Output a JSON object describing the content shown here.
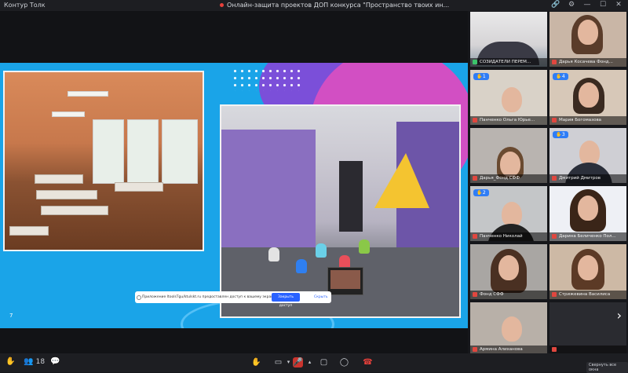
{
  "app": {
    "title": "Контур Толк"
  },
  "meeting": {
    "title": "Онлайн-защита проектов ДОП конкурса \"Пространство твоих ин..."
  },
  "top_icons": [
    "link-icon",
    "gear-icon",
    "minimize-icon",
    "maximize-icon",
    "close-icon"
  ],
  "slide": {
    "page_number": "7"
  },
  "share_notice": {
    "text": "Приложение ltoolsTgu/ktulskt.ru предоставлен доступ к вашему экрану.",
    "stop_label": "Закрыть доступ",
    "hide_label": "Скрыть"
  },
  "participants": [
    {
      "name": "СОЗИДАТЕЛИ ПЕРЕМ...",
      "mic_on": true,
      "badge": ""
    },
    {
      "name": "Дарья Косачева Фонд...",
      "mic_on": false,
      "badge": ""
    },
    {
      "name": "Панченко Ольга Юрье...",
      "mic_on": false,
      "badge": "1"
    },
    {
      "name": "Мария Богомазова",
      "mic_on": false,
      "badge": "4"
    },
    {
      "name": "Дарья_Фонд СФФ",
      "mic_on": false,
      "badge": ""
    },
    {
      "name": "Дмитрий Дмитров",
      "mic_on": false,
      "badge": "3"
    },
    {
      "name": "Панченко Николай",
      "mic_on": false,
      "badge": "2"
    },
    {
      "name": "Дарина Беличенко Пол...",
      "mic_on": false,
      "badge": ""
    },
    {
      "name": "Фонд СФФ",
      "mic_on": false,
      "badge": ""
    },
    {
      "name": "Стрижевина Василиса",
      "mic_on": false,
      "badge": ""
    },
    {
      "name": "Армина Алиханова",
      "mic_on": false,
      "badge": ""
    },
    {
      "name": "",
      "mic_on": false,
      "badge": ""
    }
  ],
  "sidebar_footer": {
    "show_all_label": "Свернуть все окна"
  },
  "bottom": {
    "participant_count": "18"
  }
}
